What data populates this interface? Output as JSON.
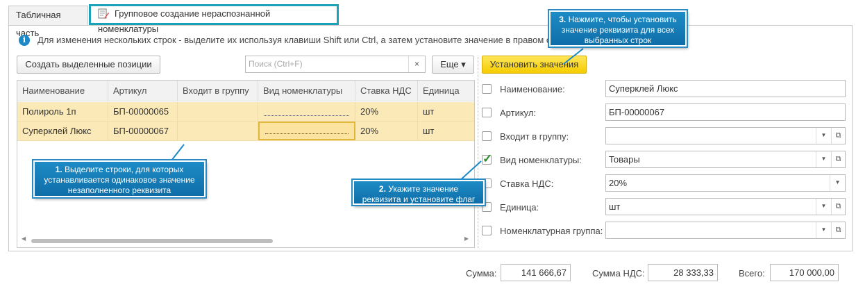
{
  "tabs": {
    "table": "Табличная часть",
    "group": "Групповое создание нераспознанной номенклатуры"
  },
  "info": {
    "text": "Для изменения нескольких строк - выделите их используя клавиши Shift или Ctrl, а затем установите значение в правом о"
  },
  "toolbar": {
    "create_selected": "Создать выделенные позиции",
    "search_placeholder": "Поиск (Ctrl+F)",
    "search_clear": "×",
    "more": "Еще ▾",
    "set_values": "Установить значения"
  },
  "table": {
    "columns": [
      "Наименование",
      "Артикул",
      "Входит в группу",
      "Вид номенклатуры",
      "Ставка НДС",
      "Единица"
    ],
    "rows": [
      [
        "Полироль 1п",
        "БП-00000065",
        "",
        "",
        "20%",
        "шт"
      ],
      [
        "Суперклей Люкс",
        "БП-00000067",
        "",
        "",
        "20%",
        "шт"
      ]
    ]
  },
  "form": {
    "fields": [
      {
        "label": "Наименование:",
        "value": "Суперклей Люкс",
        "checked": false
      },
      {
        "label": "Артикул:",
        "value": "БП-00000067",
        "checked": false
      },
      {
        "label": "Входит в группу:",
        "value": "",
        "checked": false
      },
      {
        "label": "Вид номенклатуры:",
        "value": "Товары",
        "checked": true
      },
      {
        "label": "Ставка НДС:",
        "value": "20%",
        "checked": false
      },
      {
        "label": "Единица:",
        "value": "шт",
        "checked": false
      },
      {
        "label": "Номенклатурная группа:",
        "value": "",
        "checked": false
      }
    ]
  },
  "totals": {
    "sum_label": "Сумма:",
    "sum": "141 666,67",
    "vat_label": "Сумма НДС:",
    "vat": "28 333,33",
    "total_label": "Всего:",
    "total": "170 000,00"
  },
  "callouts": {
    "c1_num": "1.",
    "c1_text": "Выделите строки, для которых устанавливается одинаковое значение незаполненного реквизита",
    "c2_num": "2.",
    "c2_text": "Укажите значение реквизита и установите флаг",
    "c3_num": "3.",
    "c3_text": "Нажмите, чтобы установить значение реквизита для всех выбранных строк"
  },
  "colors": {
    "accent": "#1aa3b8",
    "callout": "#1a88c9",
    "row_highlight": "#fbe9b7",
    "button_yellow": "#f5cc00"
  }
}
